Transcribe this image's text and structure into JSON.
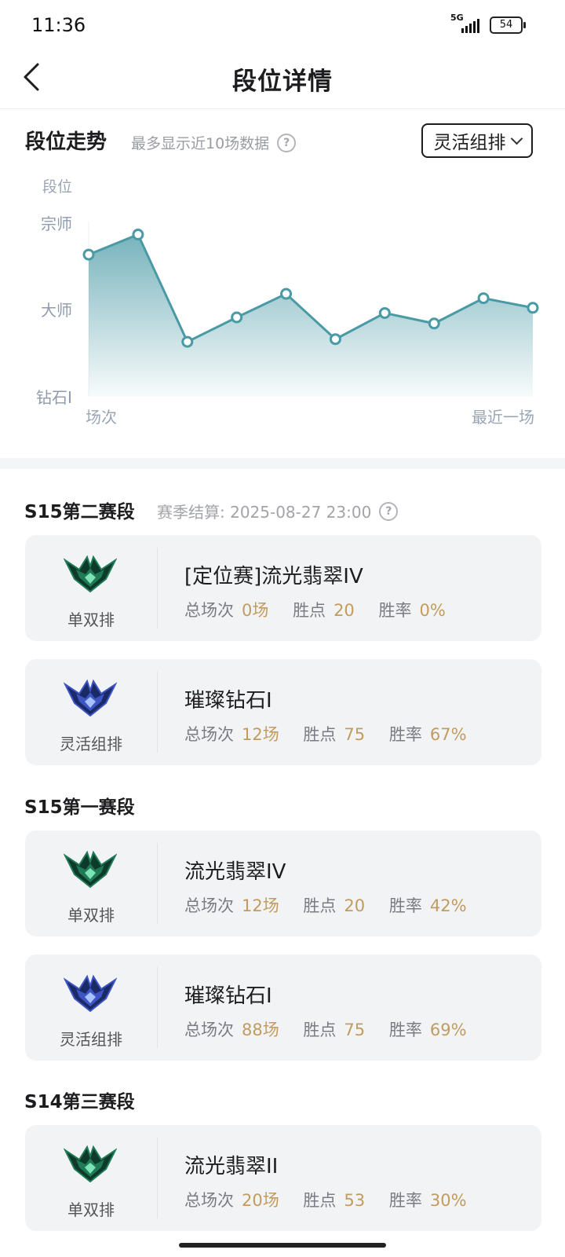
{
  "status_bar": {
    "time": "11:36",
    "network": "5G",
    "battery": "54"
  },
  "header": {
    "title": "段位详情"
  },
  "trend": {
    "title": "段位走势",
    "hint": "最多显示近10场数据",
    "mode_select": {
      "selected": "灵活组排"
    }
  },
  "chart_data": {
    "type": "area",
    "ylabel": "段位",
    "y_ticks": [
      "宗师",
      "大师",
      "钻石I"
    ],
    "x_start_label": "场次",
    "x_end_label": "最近一场",
    "values": [
      1.63,
      1.86,
      0.63,
      0.91,
      1.18,
      0.66,
      0.96,
      0.84,
      1.13,
      1.02
    ],
    "ylim": [
      0,
      2
    ],
    "color": "#4a9aa6"
  },
  "seasons": [
    {
      "name": "S15第二赛段",
      "settle": "赛季结算: 2025-08-27 23:00",
      "cards": [
        {
          "queue": "单双排",
          "emblem": "emerald",
          "rank": "[定位赛]流光翡翠IV",
          "games_label": "总场次",
          "games": "0场",
          "lp_label": "胜点",
          "lp": "20",
          "wr_label": "胜率",
          "wr": "0%"
        },
        {
          "queue": "灵活组排",
          "emblem": "diamond",
          "rank": "璀璨钻石I",
          "games_label": "总场次",
          "games": "12场",
          "lp_label": "胜点",
          "lp": "75",
          "wr_label": "胜率",
          "wr": "67%"
        }
      ]
    },
    {
      "name": "S15第一赛段",
      "cards": [
        {
          "queue": "单双排",
          "emblem": "emerald",
          "rank": "流光翡翠IV",
          "games_label": "总场次",
          "games": "12场",
          "lp_label": "胜点",
          "lp": "20",
          "wr_label": "胜率",
          "wr": "42%"
        },
        {
          "queue": "灵活组排",
          "emblem": "diamond",
          "rank": "璀璨钻石I",
          "games_label": "总场次",
          "games": "88场",
          "lp_label": "胜点",
          "lp": "75",
          "wr_label": "胜率",
          "wr": "69%"
        }
      ]
    },
    {
      "name": "S14第三赛段",
      "cards": [
        {
          "queue": "单双排",
          "emblem": "emerald",
          "rank": "流光翡翠II",
          "games_label": "总场次",
          "games": "20场",
          "lp_label": "胜点",
          "lp": "53",
          "wr_label": "胜率",
          "wr": "30%"
        }
      ]
    }
  ]
}
